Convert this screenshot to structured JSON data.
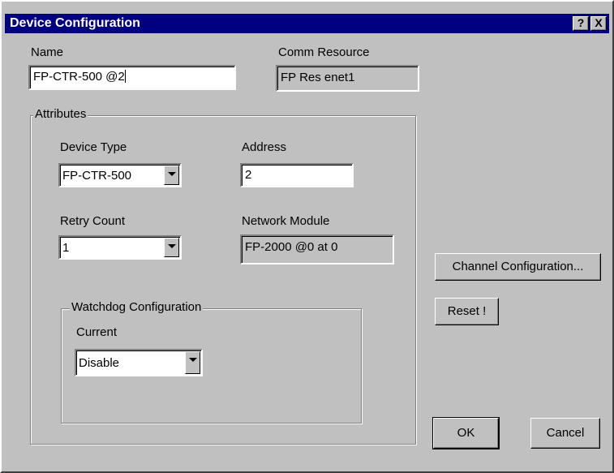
{
  "window": {
    "title": "Device Configuration",
    "help_button": "?",
    "close_button": "X"
  },
  "name": {
    "label": "Name",
    "value": "FP-CTR-500 @2"
  },
  "comm_resource": {
    "label": "Comm Resource",
    "value": "FP Res enet1"
  },
  "attributes": {
    "group_label": "Attributes",
    "device_type": {
      "label": "Device Type",
      "value": "FP-CTR-500"
    },
    "address": {
      "label": "Address",
      "value": "2"
    },
    "retry_count": {
      "label": "Retry Count",
      "value": "1"
    },
    "network_module": {
      "label": "Network Module",
      "value": "FP-2000 @0 at 0"
    },
    "watchdog": {
      "group_label": "Watchdog Configuration",
      "current_label": "Current",
      "current_value": "Disable"
    }
  },
  "buttons": {
    "channel_configuration": "Channel Configuration...",
    "reset": "Reset !",
    "ok": "OK",
    "cancel": "Cancel"
  }
}
